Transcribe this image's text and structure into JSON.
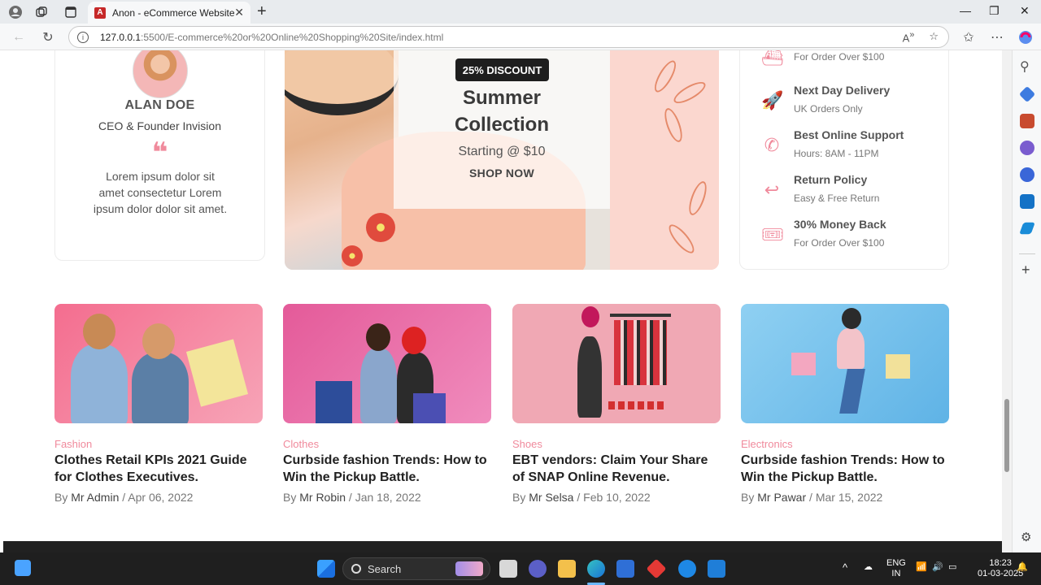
{
  "browser": {
    "tab_title": "Anon - eCommerce Website",
    "tab_favicon": "A",
    "url_host": "127.0.0.1",
    "url_path": ":5500/E-commerce%20or%20Online%20Shopping%20Site/index.html",
    "accent": "#c62828"
  },
  "testimonial": {
    "name": "ALAN DOE",
    "role": "CEO & Founder Invision",
    "quote_mark": "❝",
    "text": "Lorem ipsum dolor sit amet consectetur Lorem ipsum dolor dolor sit amet."
  },
  "banner": {
    "badge": "25% DISCOUNT",
    "title_line1": "Summer",
    "title_line2": "Collection",
    "subtitle": "Starting @ $10",
    "cta": "SHOP NOW"
  },
  "services": [
    {
      "icon": "ship-icon",
      "glyph": "⛴",
      "title": "",
      "sub": "For Order Over $100"
    },
    {
      "icon": "rocket-icon",
      "glyph": "🚀",
      "title": "Next Day Delivery",
      "sub": "UK Orders Only"
    },
    {
      "icon": "phone-icon",
      "glyph": "✆",
      "title": "Best Online Support",
      "sub": "Hours: 8AM - 11PM"
    },
    {
      "icon": "return-icon",
      "glyph": "↩",
      "title": "Return Policy",
      "sub": "Easy & Free Return"
    },
    {
      "icon": "ticket-icon",
      "glyph": "🎟",
      "title": "30% Money Back",
      "sub": "For Order Over $100"
    }
  ],
  "blogs": [
    {
      "category": "Fashion",
      "title": "Clothes Retail KPIs 2021 Guide for Clothes Executives.",
      "by": "By",
      "author": "Mr Admin",
      "date": "Apr 06, 2022"
    },
    {
      "category": "Clothes",
      "title": "Curbside fashion Trends: How to Win the Pickup Battle.",
      "by": "By",
      "author": "Mr Robin",
      "date": "Jan 18, 2022"
    },
    {
      "category": "Shoes",
      "title": "EBT vendors: Claim Your Share of SNAP Online Revenue.",
      "by": "By",
      "author": "Mr Selsa",
      "date": "Feb 10, 2022"
    },
    {
      "category": "Electronics",
      "title": "Curbside fashion Trends: How to Win the Pickup Battle.",
      "by": "By",
      "author": "Mr Pawar",
      "date": "Mar 15, 2022"
    }
  ],
  "taskbar": {
    "search_placeholder": "Search",
    "lang_top": "ENG",
    "lang_bottom": "IN",
    "time": "18:23",
    "date": "01-03-2025"
  }
}
